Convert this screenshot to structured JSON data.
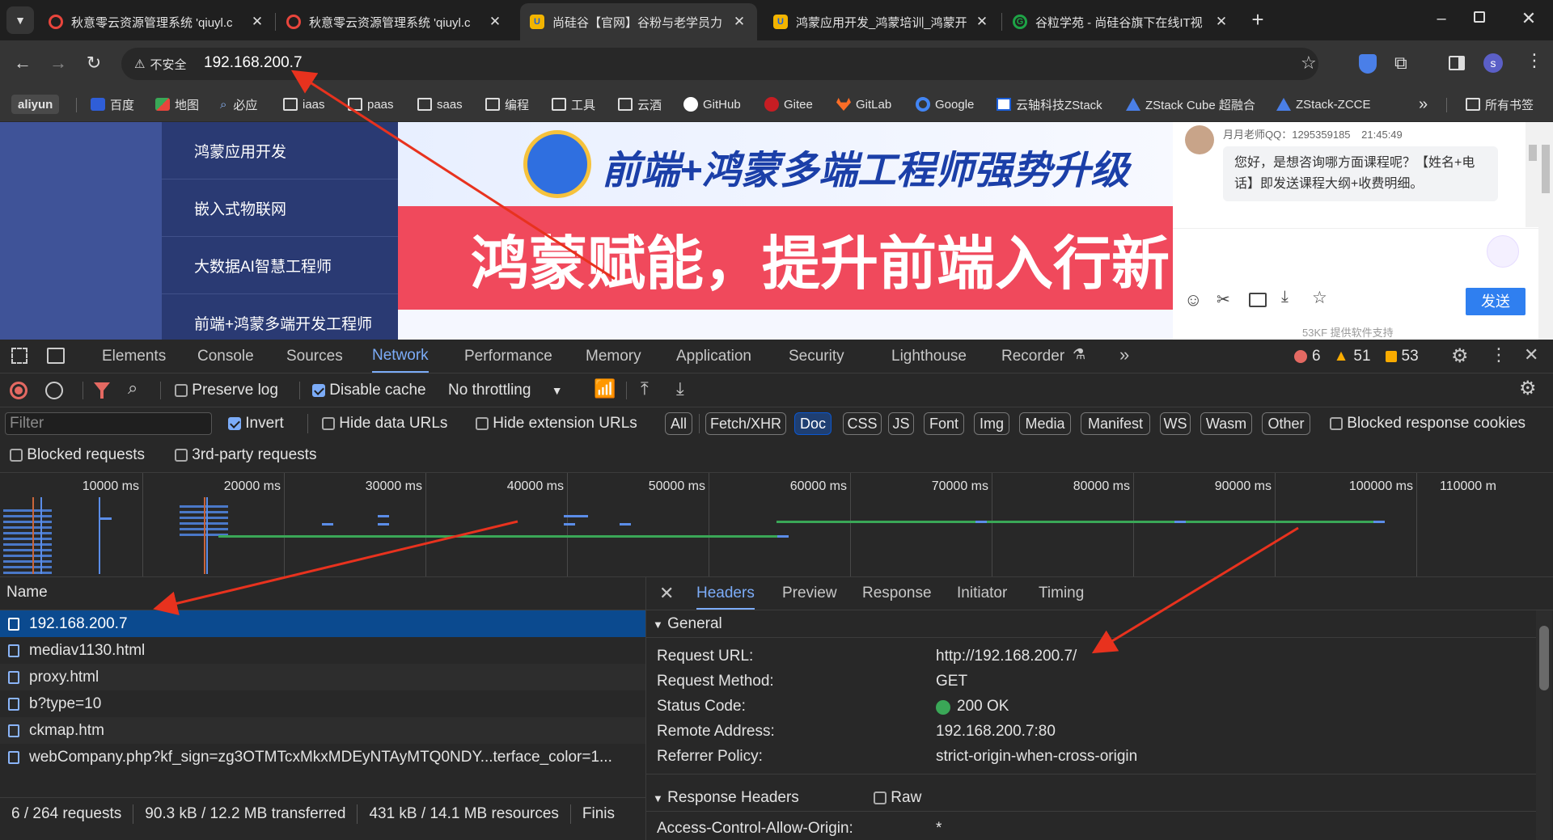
{
  "browser": {
    "tabs": [
      {
        "title": "秋意零云资源管理系统 'qiuyl.c",
        "icon_color": "#e8453c",
        "active": false
      },
      {
        "title": "秋意零云资源管理系统 'qiuyl.c",
        "icon_color": "#e8453c",
        "active": false
      },
      {
        "title": "尚硅谷【官网】谷粉与老学员力",
        "icon_color": "#f2b400",
        "active": true
      },
      {
        "title": "鸿蒙应用开发_鸿蒙培训_鸿蒙开",
        "icon_color": "#f2b400",
        "active": false
      },
      {
        "title": "谷粒学苑 - 尚硅谷旗下在线IT视",
        "icon_color": "#1ea446",
        "active": false
      }
    ],
    "new_tab": "+",
    "security_label": "不安全",
    "url": "192.168.200.7",
    "profile_initial": "s",
    "bookmarks": [
      {
        "label": "aliyun",
        "type": "text"
      },
      {
        "label": "百度",
        "type": "icon"
      },
      {
        "label": "地图",
        "type": "icon"
      },
      {
        "label": "必应",
        "type": "icon"
      },
      {
        "label": "iaas",
        "type": "folder"
      },
      {
        "label": "paas",
        "type": "folder"
      },
      {
        "label": "saas",
        "type": "folder"
      },
      {
        "label": "编程",
        "type": "folder"
      },
      {
        "label": "工具",
        "type": "folder"
      },
      {
        "label": "云酒",
        "type": "folder"
      },
      {
        "label": "GitHub",
        "type": "icon"
      },
      {
        "label": "Gitee",
        "type": "icon"
      },
      {
        "label": "GitLab",
        "type": "icon"
      },
      {
        "label": "Google",
        "type": "icon"
      },
      {
        "label": "云轴科技ZStack",
        "type": "icon"
      },
      {
        "label": "ZStack Cube 超融合",
        "type": "icon"
      },
      {
        "label": "ZStack-ZCCE",
        "type": "icon"
      }
    ],
    "more_bookmarks": "»",
    "all_bookmarks": "所有书签"
  },
  "page": {
    "menu_items": [
      "鸿蒙应用开发",
      "嵌入式物联网",
      "大数据AI智慧工程师",
      "前端+鸿蒙多端开发工程师"
    ],
    "banner_title": "前端+鸿蒙多端工程师强势升级",
    "banner_slogan": "鸿蒙赋能，提升前端入行新",
    "chat": {
      "sender": "月月老师QQ：1295359185",
      "time": "21:45:49",
      "message": "您好，是想咨询哪方面课程呢？【姓名+电话】即发送课程大纲+收费明细。",
      "send_button": "发送",
      "footer": "53KF 提供软件支持"
    }
  },
  "devtools": {
    "tabs": [
      "Elements",
      "Console",
      "Sources",
      "Network",
      "Performance",
      "Memory",
      "Application",
      "Security",
      "Lighthouse",
      "Recorder"
    ],
    "active_tab": "Network",
    "errors": "6",
    "warnings": "51",
    "issues": "53",
    "toolbar": {
      "preserve_log": "Preserve log",
      "disable_cache": "Disable cache",
      "throttling": "No throttling"
    },
    "filter": {
      "placeholder": "Filter",
      "invert": "Invert",
      "hide_data_urls": "Hide data URLs",
      "hide_extension_urls": "Hide extension URLs",
      "types": [
        "All",
        "Fetch/XHR",
        "Doc",
        "CSS",
        "JS",
        "Font",
        "Img",
        "Media",
        "Manifest",
        "WS",
        "Wasm",
        "Other"
      ],
      "active_type": "Doc",
      "blocked_cookies": "Blocked response cookies",
      "blocked_requests": "Blocked requests",
      "third_party": "3rd-party requests"
    },
    "timeline_ticks": [
      "10000 ms",
      "20000 ms",
      "30000 ms",
      "40000 ms",
      "50000 ms",
      "60000 ms",
      "70000 ms",
      "80000 ms",
      "90000 ms",
      "100000 ms",
      "110000 m"
    ],
    "name_header": "Name",
    "requests": [
      "192.168.200.7",
      "mediav1130.html",
      "proxy.html",
      "b?type=10",
      "ckmap.htm",
      "webCompany.php?kf_sign=zg3OTMTcxMkxMDEyNTAyMTQ0NDY...terface_color=1..."
    ],
    "status": {
      "requests": "6 / 264 requests",
      "transferred": "90.3 kB / 12.2 MB transferred",
      "resources": "431 kB / 14.1 MB resources",
      "finish": "Finis"
    },
    "detail_tabs": [
      "Headers",
      "Preview",
      "Response",
      "Initiator",
      "Timing"
    ],
    "active_detail_tab": "Headers",
    "general_title": "General",
    "general": [
      {
        "key": "Request URL:",
        "value": "http://192.168.200.7/"
      },
      {
        "key": "Request Method:",
        "value": "GET"
      },
      {
        "key": "Status Code:",
        "value": "200 OK"
      },
      {
        "key": "Remote Address:",
        "value": "192.168.200.7:80"
      },
      {
        "key": "Referrer Policy:",
        "value": "strict-origin-when-cross-origin"
      }
    ],
    "response_headers_title": "Response Headers",
    "raw_label": "Raw",
    "partial_header": "Access-Control-Allow-Origin:",
    "partial_value": "*"
  }
}
